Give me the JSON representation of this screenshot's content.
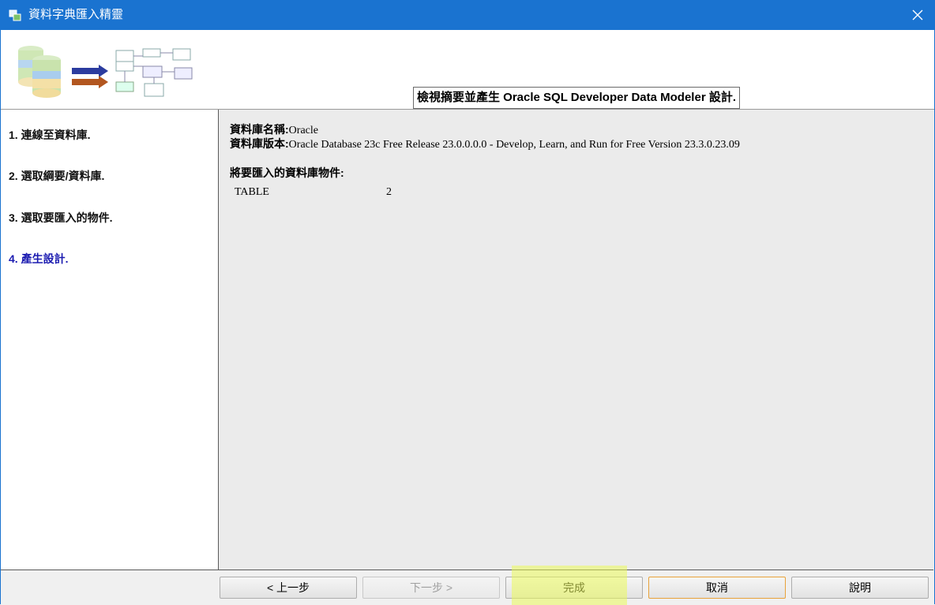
{
  "window": {
    "title": "資料字典匯入精靈",
    "close_icon": "close-icon"
  },
  "header": {
    "message": "檢視摘要並產生 Oracle SQL Developer Data Modeler 設計."
  },
  "steps": [
    {
      "label": "1. 連線至資料庫."
    },
    {
      "label": "2. 選取綱要/資料庫."
    },
    {
      "label": "3. 選取要匯入的物件."
    },
    {
      "label": "4. 產生設計.",
      "active": true
    }
  ],
  "summary": {
    "db_name_label": "資料庫名稱:",
    "db_name_value": "Oracle",
    "db_version_label": "資料庫版本:",
    "db_version_value": "Oracle Database 23c Free Release 23.0.0.0.0 - Develop, Learn, and Run for Free Version 23.3.0.23.09",
    "objects_title": "將要匯入的資料庫物件:",
    "objects": [
      {
        "type": "TABLE",
        "count": "2"
      }
    ]
  },
  "buttons": {
    "back": "< 上一步",
    "next": "下一步 >",
    "finish": "完成",
    "cancel": "取消",
    "help": "說明"
  },
  "colors": {
    "titlebar": "#1a73d0",
    "active_step": "#1a1ab0",
    "highlight": "#ebfa5a"
  }
}
